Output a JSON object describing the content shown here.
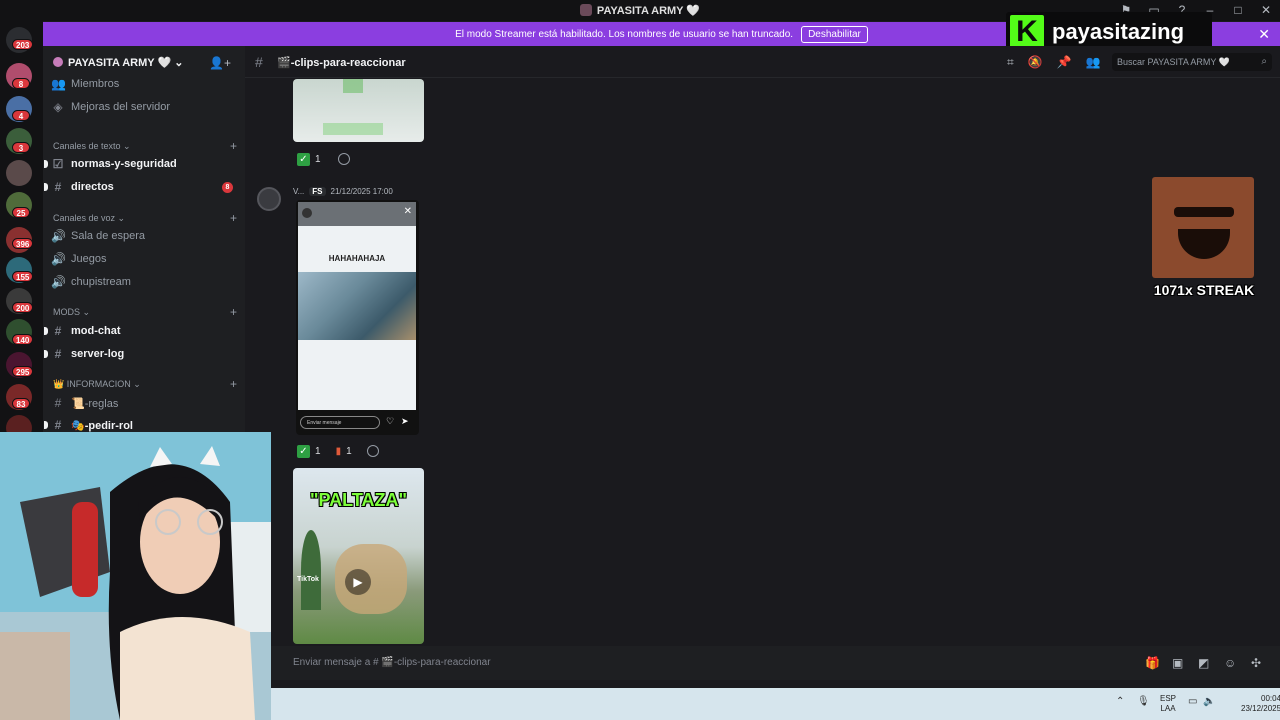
{
  "window": {
    "title": "PAYASITA ARMY 🤍"
  },
  "banner": {
    "text": "El modo Streamer está habilitado. Los nombres de usuario se han truncado.",
    "button": "Deshabilitar"
  },
  "kick": {
    "channel": "payasitazing",
    "logo_letter": "K"
  },
  "rail": {
    "badges": [
      "203",
      "8",
      "4",
      "3",
      "25",
      "396",
      "155",
      "200",
      "140",
      "295",
      "83"
    ]
  },
  "sidebar": {
    "server_name": "PAYASITA ARMY 🤍",
    "items": [
      {
        "label": "Miembros",
        "icon": "members-icon"
      },
      {
        "label": "Mejoras del servidor",
        "icon": "boost-icon"
      }
    ],
    "categories": {
      "text": "Canales de texto",
      "voice": "Canales de voz",
      "mods": "MODS",
      "info": "INFORMACION"
    },
    "text_channels": [
      {
        "label": "normas-y-seguridad"
      },
      {
        "label": "directos",
        "mentions": "8"
      }
    ],
    "voice_channels": [
      {
        "label": "Sala de espera"
      },
      {
        "label": "Juegos"
      },
      {
        "label": "chupistream"
      }
    ],
    "mod_channels": [
      {
        "label": "mod-chat"
      },
      {
        "label": "server-log"
      }
    ],
    "info_channels": [
      {
        "label": "📜-reglas"
      },
      {
        "label": "🎭-pedir-rol"
      }
    ]
  },
  "header": {
    "channel": "🎬-clips-para-reaccionar",
    "search_placeholder": "Buscar PAYASITA ARMY 🤍"
  },
  "messages": {
    "first_reactions": {
      "check_count": "1"
    },
    "author": "V...",
    "author_tag": "FS",
    "timestamp": "21/12/2025 17:00",
    "story_caption": "HAHAHAHAJA",
    "story_reply_placeholder": "Enviar mensaje",
    "second_reactions": {
      "check_count": "1",
      "other_count": "1"
    },
    "clip_title": "\"PALTAZA\"",
    "clip_brand": "TikTok"
  },
  "composer": {
    "placeholder": "Enviar mensaje a # 🎬-clips-para-reaccionar"
  },
  "taskbar": {
    "lang_top": "ESP",
    "lang_bottom": "LAA",
    "time": "00:04",
    "date": "23/12/2025"
  },
  "overlay": {
    "streak_text": "1071x STREAK"
  },
  "colors": {
    "banner": "#8b3ee0",
    "kick_green": "#53fc18",
    "mention": "#da373c"
  }
}
